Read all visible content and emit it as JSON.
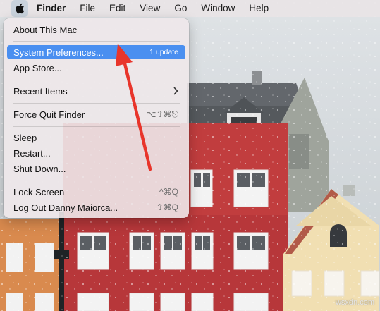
{
  "menubar": {
    "apple_icon": "apple-logo-icon",
    "items": [
      "Finder",
      "File",
      "Edit",
      "View",
      "Go",
      "Window",
      "Help"
    ]
  },
  "apple_menu": {
    "about": "About This Mac",
    "system_preferences": "System Preferences...",
    "system_preferences_badge": "1 update",
    "app_store": "App Store...",
    "recent_items": "Recent Items",
    "force_quit": "Force Quit Finder",
    "force_quit_shortcut": "⌥⇧⌘⎋",
    "sleep": "Sleep",
    "restart": "Restart...",
    "shut_down": "Shut Down...",
    "lock_screen": "Lock Screen",
    "lock_screen_shortcut": "^⌘Q",
    "log_out": "Log Out Danny Maiorca...",
    "log_out_shortcut": "⇧⌘Q"
  },
  "colors": {
    "selection": "#4a8ff0",
    "arrow": "#e8352b"
  },
  "watermark": "wsxdn.com"
}
